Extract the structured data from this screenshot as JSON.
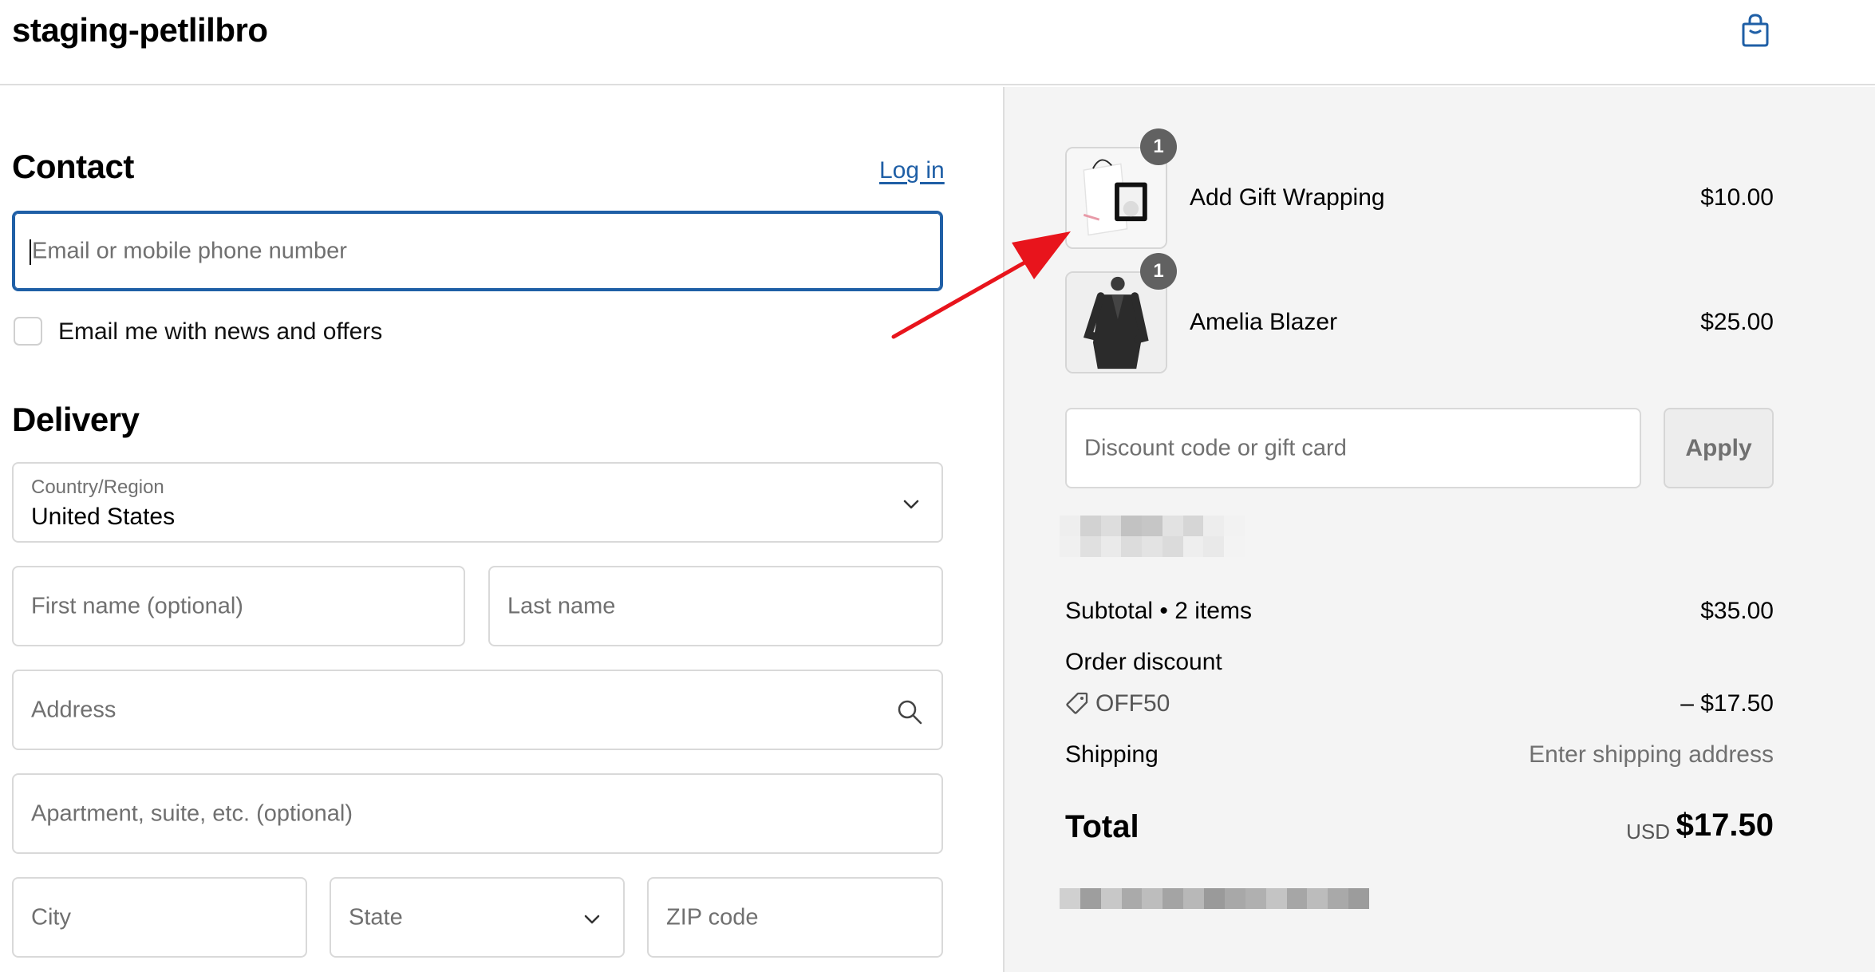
{
  "header": {
    "store_name": "staging-petlilbro",
    "bag_icon": "shopping-bag-icon"
  },
  "contact": {
    "title": "Contact",
    "login_label": "Log in",
    "email_placeholder": "Email or mobile phone number",
    "newsletter_label": "Email me with news and offers"
  },
  "delivery": {
    "title": "Delivery",
    "country_label": "Country/Region",
    "country_value": "United States",
    "first_name_placeholder": "First name (optional)",
    "last_name_placeholder": "Last name",
    "address_placeholder": "Address",
    "apartment_placeholder": "Apartment, suite, etc. (optional)",
    "city_placeholder": "City",
    "state_placeholder": "State",
    "zip_placeholder": "ZIP code"
  },
  "cart": {
    "items": [
      {
        "name": "Add Gift Wrapping",
        "price": "$10.00",
        "quantity": "1"
      },
      {
        "name": "Amelia Blazer",
        "price": "$25.00",
        "quantity": "1"
      }
    ],
    "discount_placeholder": "Discount code or gift card",
    "apply_label": "Apply"
  },
  "summary": {
    "subtotal_label": "Subtotal • 2 items",
    "subtotal_value": "$35.00",
    "order_discount_label": "Order discount",
    "discount_code": "OFF50",
    "discount_value": "– $17.50",
    "shipping_label": "Shipping",
    "shipping_value": "Enter shipping address",
    "total_label": "Total",
    "total_currency": "USD",
    "total_value": "$17.50"
  },
  "colors": {
    "link": "#1f5fa6",
    "focus_border": "#1f5fa6",
    "annotation_arrow": "#e8141c",
    "summary_background": "#f4f4f4"
  }
}
